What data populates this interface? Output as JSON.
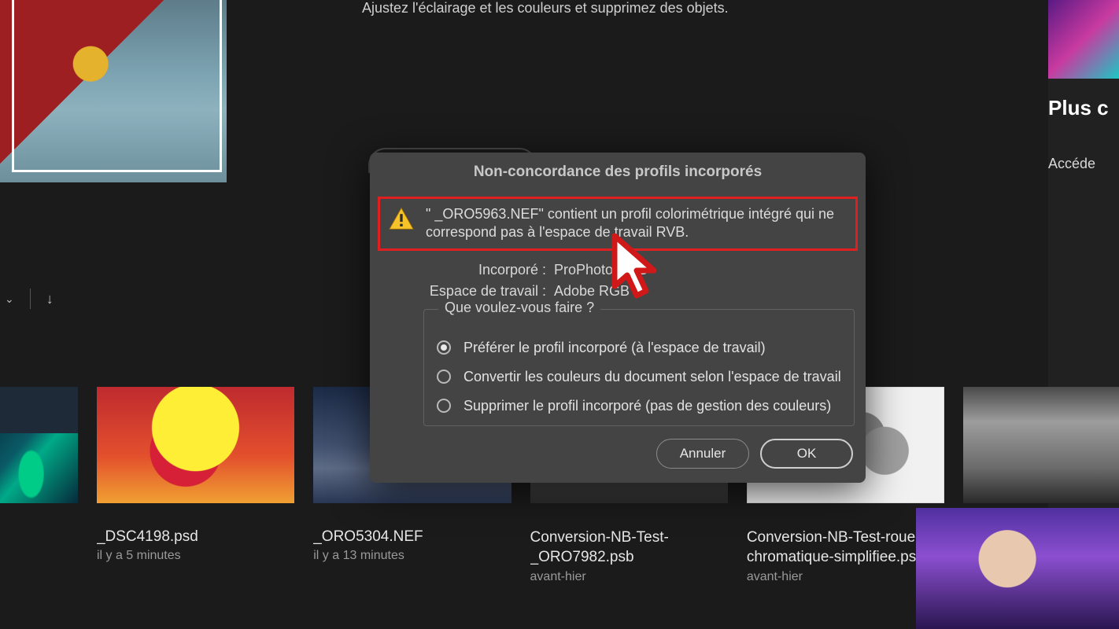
{
  "header_text": "Ajustez l'éclairage et les couleurs et supprimez des objets.",
  "right_panel": {
    "plus": "Plus c",
    "accede": "Accéde"
  },
  "dialog": {
    "title": "Non-concordance des profils incorporés",
    "warning": "\" _ORO5963.NEF\" contient un profil colorimétrique intégré qui ne correspond pas à l'espace de travail RVB.",
    "embedded_label": "Incorporé :",
    "embedded_value": "ProPhoto RGB",
    "workspace_label": "Espace de travail :",
    "workspace_value": "Adobe RGB",
    "legend": "Que voulez-vous faire ?",
    "options": [
      "Préférer le profil incorporé (à l'espace de travail)",
      "Convertir les couleurs du document selon l'espace de travail",
      "Supprimer le profil incorporé (pas de gestion des couleurs)"
    ],
    "selected_option": 0,
    "cancel": "Annuler",
    "ok": "OK"
  },
  "files": [
    {
      "name": "",
      "time": ""
    },
    {
      "name": "_DSC4198.psd",
      "time": "il y a 5 minutes"
    },
    {
      "name": "_ORO5304.NEF",
      "time": "il y a 13 minutes"
    },
    {
      "name": "Conversion-NB-Test-_ORO7982.psb",
      "time": "avant-hier"
    },
    {
      "name": "Conversion-NB-Test-roue-chromatique-simplifiee.psd",
      "time": "avant-hier"
    },
    {
      "name": "",
      "time": ""
    }
  ]
}
